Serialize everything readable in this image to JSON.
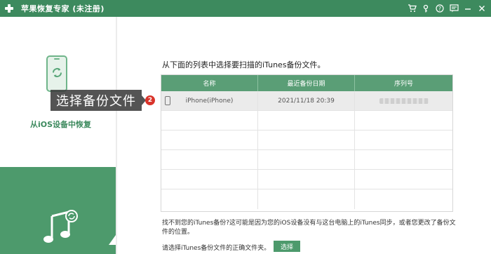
{
  "window": {
    "title": "苹果恢复专家 (未注册)",
    "icons": [
      "cart-icon",
      "key-icon",
      "help-icon",
      "feedback-icon",
      "minimize-icon",
      "close-icon"
    ]
  },
  "sidebar": {
    "items": [
      {
        "label": "从iOS设备中恢复",
        "icon": "phone-sync-icon",
        "active": true
      },
      {
        "label": "",
        "icon": "itunes-music-icon",
        "active": false
      }
    ]
  },
  "tooltip": {
    "text": "选择备份文件",
    "step": "2"
  },
  "main": {
    "instruction": "从下面的列表中选择要扫描的iTunes备份文件。",
    "table": {
      "headers": [
        "名称",
        "最近备份日期",
        "序列号"
      ],
      "rows": [
        {
          "name": "iPhone(iPhone)",
          "date": "2021/11/18 20:39",
          "serial": ""
        }
      ]
    },
    "help_text": "找不到您的iTunes备份?这可能是因为您的iOS设备没有与这台电脑上的iTunes同步，或者您更改了备份文件的位置。",
    "choose_text": "请选择iTunes备份文件的正确文件夹。",
    "select_button": "选择"
  },
  "colors": {
    "brand": "#3d8a5e",
    "header": "#5a9e76",
    "badge": "#d9342b"
  }
}
